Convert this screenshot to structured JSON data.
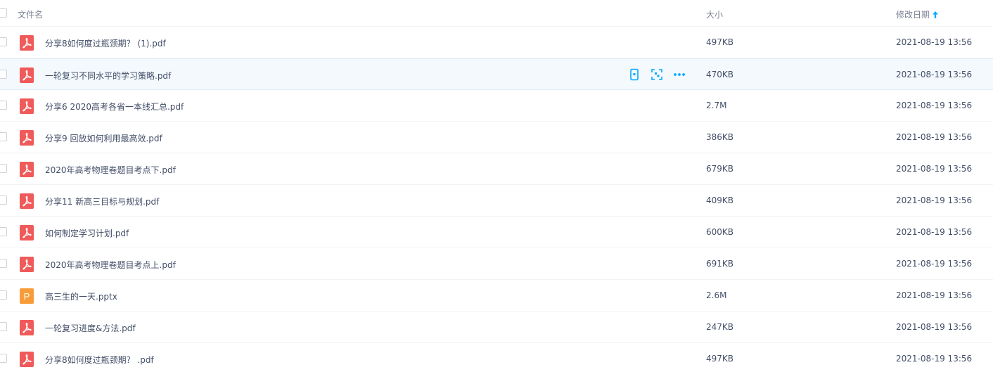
{
  "header": {
    "name_label": "文件名",
    "size_label": "大小",
    "date_label": "修改日期"
  },
  "files": [
    {
      "name": "分享8如何度过瓶颈期？ (1).pdf",
      "type": "pdf",
      "size": "497KB",
      "date": "2021-08-19 13:56"
    },
    {
      "name": "一轮复习不同水平的学习策略.pdf",
      "type": "pdf",
      "size": "470KB",
      "date": "2021-08-19 13:56"
    },
    {
      "name": "分享6 2020高考各省一本线汇总.pdf",
      "type": "pdf",
      "size": "2.7M",
      "date": "2021-08-19 13:56"
    },
    {
      "name": "分享9 回放如何利用最高效.pdf",
      "type": "pdf",
      "size": "386KB",
      "date": "2021-08-19 13:56"
    },
    {
      "name": "2020年高考物理卷题目考点下.pdf",
      "type": "pdf",
      "size": "679KB",
      "date": "2021-08-19 13:56"
    },
    {
      "name": "分享11 新高三目标与规划.pdf",
      "type": "pdf",
      "size": "409KB",
      "date": "2021-08-19 13:56"
    },
    {
      "name": "如何制定学习计划.pdf",
      "type": "pdf",
      "size": "600KB",
      "date": "2021-08-19 13:56"
    },
    {
      "name": "2020年高考物理卷题目考点上.pdf",
      "type": "pdf",
      "size": "691KB",
      "date": "2021-08-19 13:56"
    },
    {
      "name": "高三生的一天.pptx",
      "type": "pptx",
      "size": "2.6M",
      "date": "2021-08-19 13:56"
    },
    {
      "name": "一轮复习进度&方法.pdf",
      "type": "pdf",
      "size": "247KB",
      "date": "2021-08-19 13:56"
    },
    {
      "name": "分享8如何度过瓶颈期？ .pdf",
      "type": "pdf",
      "size": "497KB",
      "date": "2021-08-19 13:56"
    }
  ],
  "hover_row_index": 1,
  "row_actions": [
    "phone-icon",
    "share-scan-icon",
    "more-icon"
  ],
  "icons": {
    "pdf": "pdf-file-icon",
    "pptx": "pptx-file-icon",
    "pptx_letter": "P",
    "sort": "sort-ascending-arrow-icon"
  },
  "colors": {
    "pdf": "#f05a5a",
    "pptx": "#f89c3a",
    "accent": "#06a7ff",
    "text": "#424e67",
    "muted": "#7b8192"
  }
}
